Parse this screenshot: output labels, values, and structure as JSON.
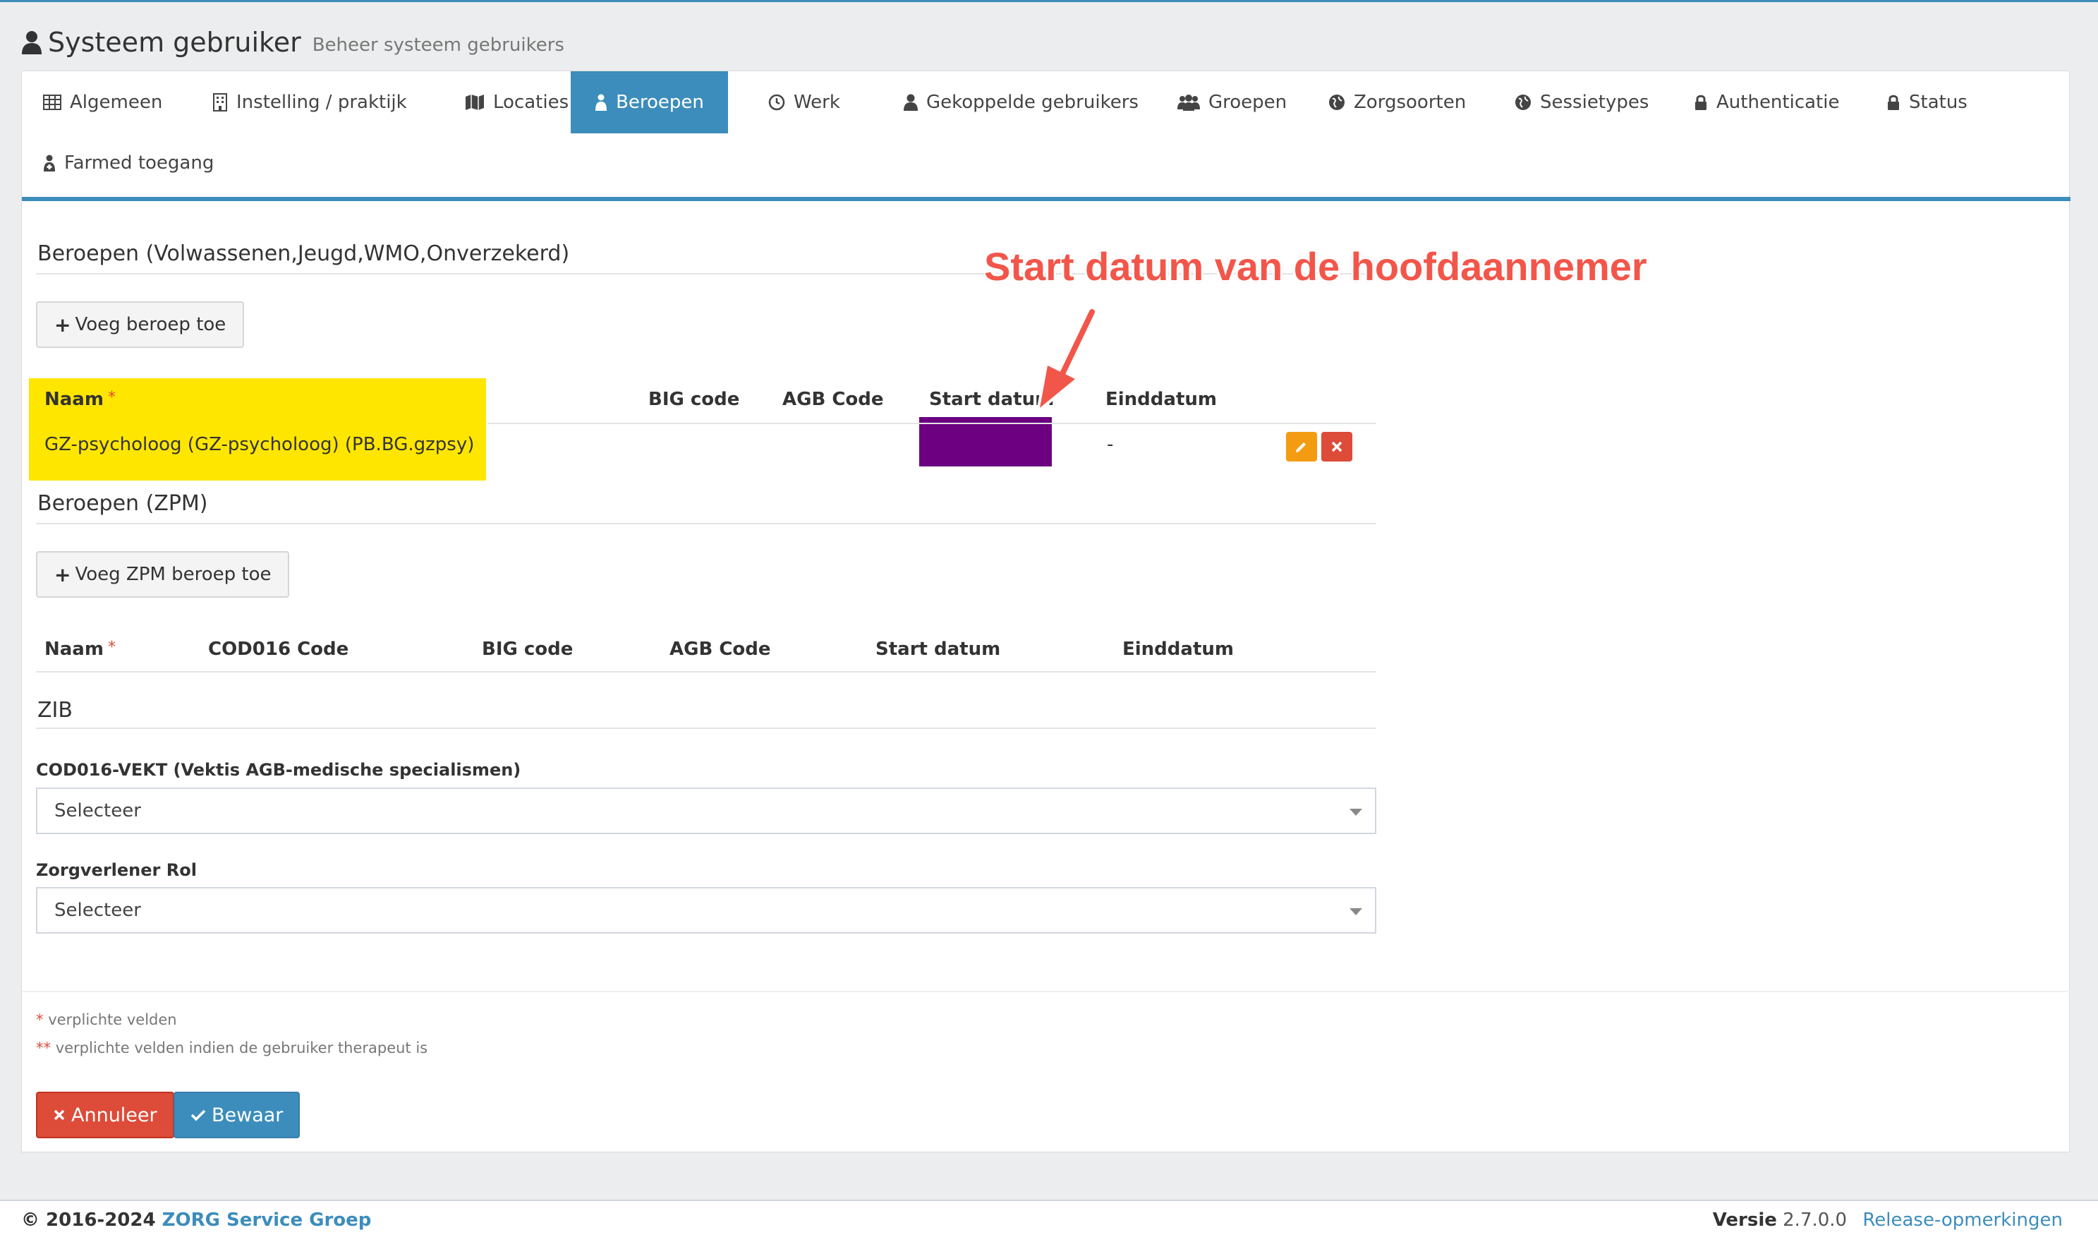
{
  "header": {
    "title": "Systeem gebruiker",
    "subtitle": "Beheer systeem gebruikers"
  },
  "tabs": [
    {
      "label": "Algemeen",
      "icon": "table-icon"
    },
    {
      "label": "Instelling / praktijk",
      "icon": "building-icon"
    },
    {
      "label": "Locaties",
      "icon": "map-icon"
    },
    {
      "label": "Beroepen",
      "icon": "user-md-icon",
      "active": true
    },
    {
      "label": "Werk",
      "icon": "clock-icon"
    },
    {
      "label": "Gekoppelde gebruikers",
      "icon": "user-icon"
    },
    {
      "label": "Groepen",
      "icon": "users-icon"
    },
    {
      "label": "Zorgsoorten",
      "icon": "globe-icon"
    },
    {
      "label": "Sessietypes",
      "icon": "globe-icon"
    },
    {
      "label": "Authenticatie",
      "icon": "lock-icon"
    },
    {
      "label": "Status",
      "icon": "lock-icon"
    },
    {
      "label": "Farmed toegang",
      "icon": "user-md-icon"
    }
  ],
  "beroepen": {
    "title": "Beroepen (Volwassenen,Jeugd,WMO,Onverzekerd)",
    "add_label": "Voeg beroep toe",
    "columns": {
      "naam": "Naam",
      "big": "BIG code",
      "agb": "AGB Code",
      "start": "Start datum",
      "eind": "Einddatum"
    },
    "rows": [
      {
        "naam": "GZ-psycholoog (GZ-psycholoog) (PB.BG.gzpsy)",
        "big": "",
        "agb": "",
        "start": "",
        "eind": "-"
      }
    ]
  },
  "zpm": {
    "title": "Beroepen (ZPM)",
    "add_label": "Voeg ZPM beroep toe",
    "columns": {
      "naam": "Naam",
      "cod": "COD016 Code",
      "big": "BIG code",
      "agb": "AGB Code",
      "start": "Start datum",
      "eind": "Einddatum"
    }
  },
  "zib": {
    "title": "ZIB",
    "cod_label": "COD016-VEKT (Vektis AGB-medische specialismen)",
    "cod_value": "Selecteer",
    "rol_label": "Zorgverlener Rol",
    "rol_value": "Selecteer"
  },
  "notes": {
    "required": "verplichte velden",
    "required_therapist": "verplichte velden indien de gebruiker therapeut is"
  },
  "actions": {
    "cancel": "Annuleer",
    "save": "Bewaar"
  },
  "annotation": {
    "text": "Start datum van de hoofdaannemer"
  },
  "footer": {
    "copyright": "© 2016-2024",
    "company": "ZORG Service Groep",
    "version_label": "Versie",
    "version": "2.7.0.0",
    "release_notes": "Release-opmerkingen"
  },
  "colors": {
    "primary": "#3c8dbc",
    "danger": "#dd4b39",
    "warning": "#f39c12",
    "highlight": "#ffe600",
    "redacted": "#6c0080",
    "annotation": "#f2564a"
  }
}
